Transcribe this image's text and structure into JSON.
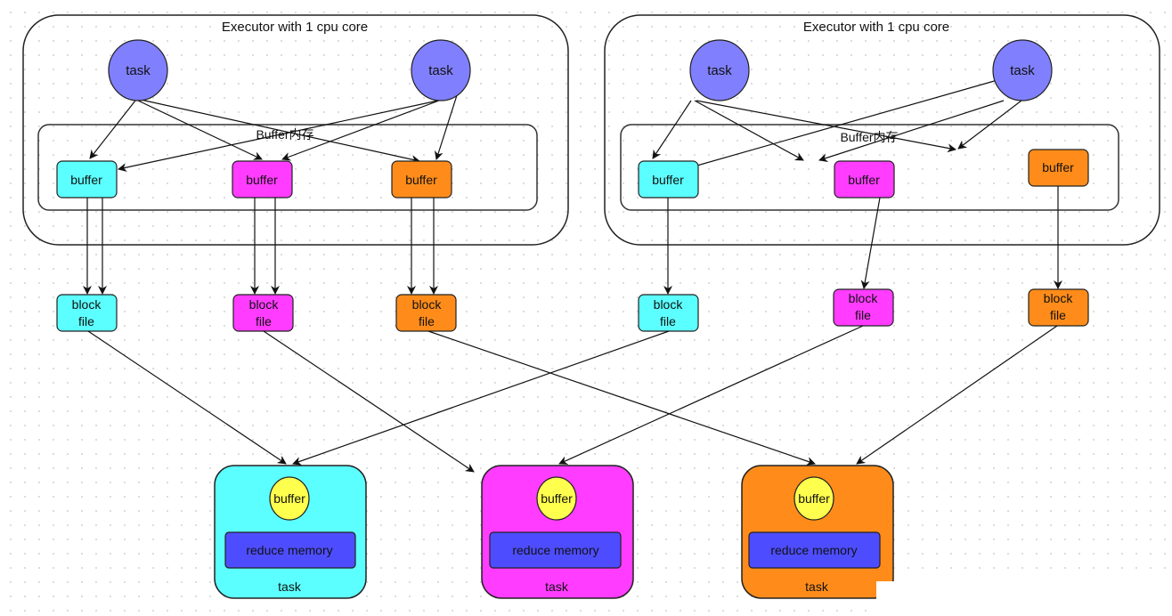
{
  "colors": {
    "task_circle": "#8080ff",
    "cyan": "#5cffff",
    "magenta": "#ff3cff",
    "orange": "#ff8c1a",
    "buffer_circle": "#ffff4d",
    "reduce_memory": "#4d4dff",
    "stroke": "#222222"
  },
  "executors": [
    {
      "title": "Executor with 1 cpu core",
      "tasks": [
        {
          "label": "task"
        },
        {
          "label": "task"
        }
      ],
      "buffer_area_label": "Buffer内存",
      "buffers": [
        {
          "label": "buffer",
          "color": "cyan"
        },
        {
          "label": "buffer",
          "color": "magenta"
        },
        {
          "label": "buffer",
          "color": "orange"
        }
      ],
      "block_files": [
        {
          "label_line1": "block",
          "label_line2": "file",
          "color": "cyan"
        },
        {
          "label_line1": "block",
          "label_line2": "file",
          "color": "magenta"
        },
        {
          "label_line1": "block",
          "label_line2": "file",
          "color": "orange"
        }
      ]
    },
    {
      "title": "Executor with 1 cpu core",
      "tasks": [
        {
          "label": "task"
        },
        {
          "label": "task"
        }
      ],
      "buffer_area_label": "Buffer内存",
      "buffers": [
        {
          "label": "buffer",
          "color": "cyan"
        },
        {
          "label": "buffer",
          "color": "magenta"
        },
        {
          "label": "buffer",
          "color": "orange"
        }
      ],
      "block_files": [
        {
          "label_line1": "block",
          "label_line2": "file",
          "color": "cyan"
        },
        {
          "label_line1": "block",
          "label_line2": "file",
          "color": "magenta"
        },
        {
          "label_line1": "block",
          "label_line2": "file",
          "color": "orange"
        }
      ]
    }
  ],
  "reduce_tasks": [
    {
      "buffer_label": "buffer",
      "memory_label": "reduce memory",
      "task_label": "task",
      "color": "cyan"
    },
    {
      "buffer_label": "buffer",
      "memory_label": "reduce memory",
      "task_label": "task",
      "color": "magenta"
    },
    {
      "buffer_label": "buffer",
      "memory_label": "reduce memory",
      "task_label": "task",
      "color": "orange"
    }
  ]
}
